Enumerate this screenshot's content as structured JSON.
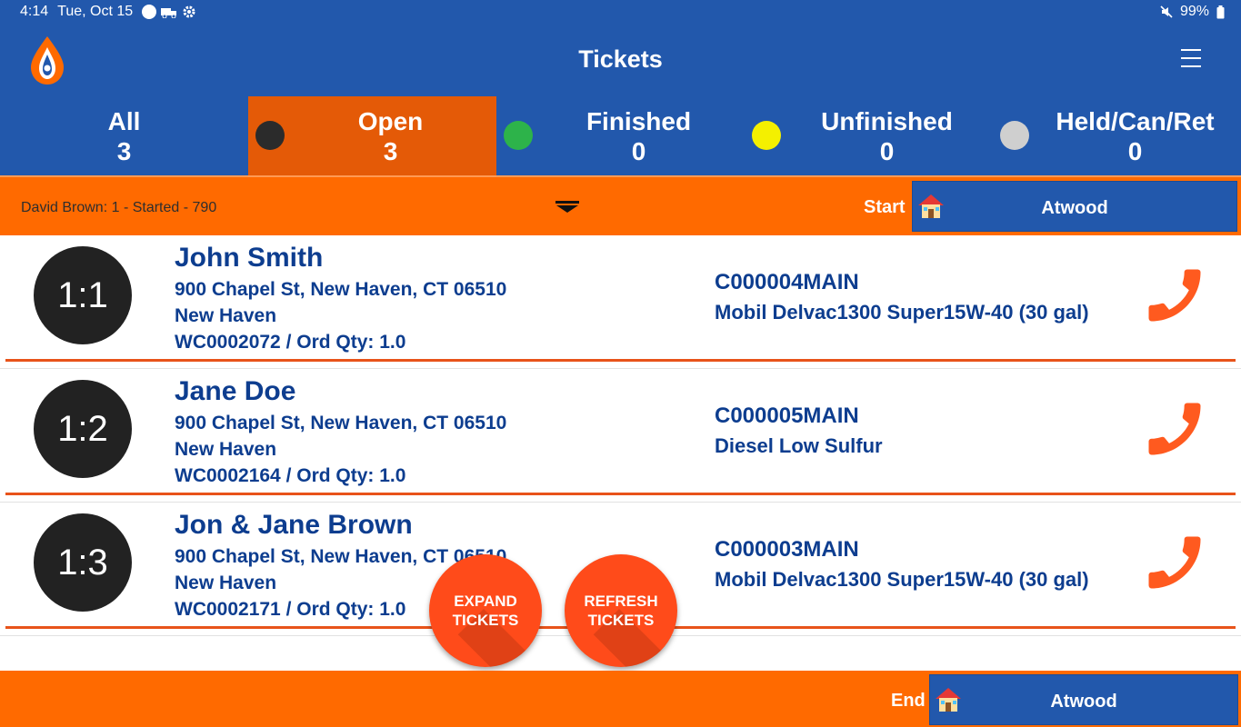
{
  "status_bar": {
    "time": "4:14",
    "date": "Tue, Oct 15",
    "battery": "99%"
  },
  "app_bar": {
    "title": "Tickets"
  },
  "tabs": [
    {
      "label": "All",
      "count": "3",
      "dot_color": ""
    },
    {
      "label": "Open",
      "count": "3",
      "dot_color": "#2b2b2b"
    },
    {
      "label": "Finished",
      "count": "0",
      "dot_color": "#2db34a"
    },
    {
      "label": "Unfinished",
      "count": "0",
      "dot_color": "#f4f000"
    },
    {
      "label": "Held/Can/Ret",
      "count": "0",
      "dot_color": "#cfcfcf"
    }
  ],
  "route_bar": {
    "driver_status": "David Brown: 1 - Started - 790",
    "start_label": "Start",
    "start_depot": "Atwood"
  },
  "tickets": [
    {
      "stop": "1:1",
      "name": "John Smith",
      "address": "900 Chapel St, New Haven, CT 06510",
      "city": "New Haven",
      "order": "WC0002072 / Ord Qty: 1.0",
      "account": "C000004MAIN",
      "product": "Mobil Delvac1300 Super15W-40 (30 gal)"
    },
    {
      "stop": "1:2",
      "name": "Jane Doe",
      "address": "900 Chapel St, New Haven, CT 06510",
      "city": "New Haven",
      "order": "WC0002164 / Ord Qty: 1.0",
      "account": "C000005MAIN",
      "product": "Diesel Low Sulfur"
    },
    {
      "stop": "1:3",
      "name": "Jon & Jane Brown",
      "address": "900 Chapel St, New Haven, CT 06510",
      "city": "New Haven",
      "order": "WC0002171 / Ord Qty: 1.0",
      "account": "C000003MAIN",
      "product": "Mobil Delvac1300 Super15W-40 (30 gal)"
    }
  ],
  "fabs": {
    "expand": "EXPAND TICKETS",
    "refresh": "REFRESH TICKETS"
  },
  "footer": {
    "end_label": "End",
    "end_depot": "Atwood"
  },
  "colors": {
    "brand_blue": "#2258ac",
    "accent_orange": "#ff6a00",
    "text_blue": "#0d3d8f",
    "phone_orange": "#ff5a1f"
  }
}
